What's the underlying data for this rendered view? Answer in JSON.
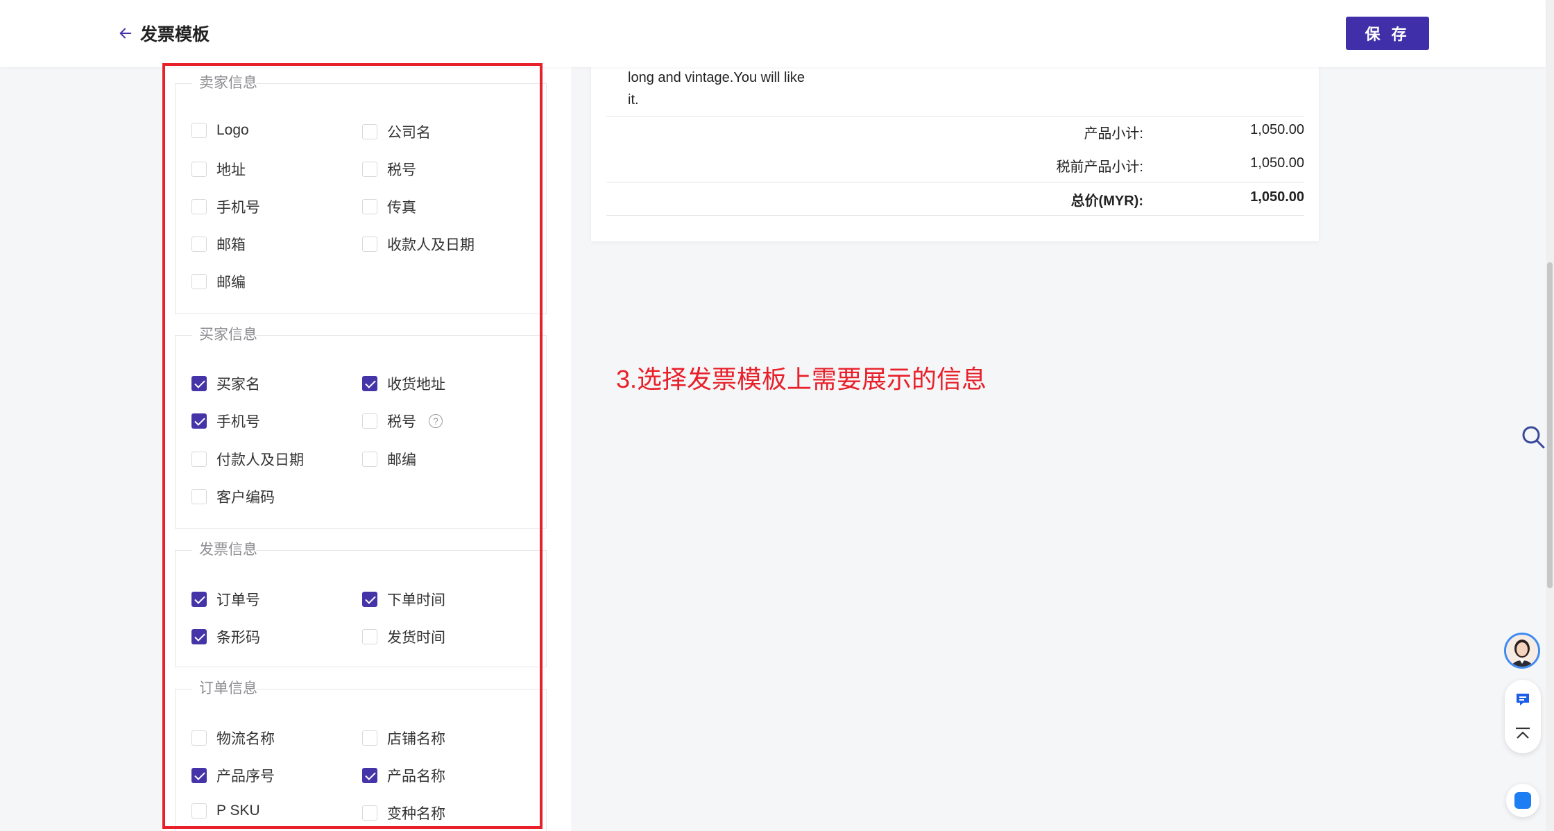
{
  "header": {
    "title": "发票模板",
    "save_label": "保 存"
  },
  "seller": {
    "legend": "卖家信息",
    "options": [
      {
        "label": "Logo",
        "checked": false
      },
      {
        "label": "公司名",
        "checked": false
      },
      {
        "label": "地址",
        "checked": false
      },
      {
        "label": "税号",
        "checked": false
      },
      {
        "label": "手机号",
        "checked": false
      },
      {
        "label": "传真",
        "checked": false
      },
      {
        "label": "邮箱",
        "checked": false
      },
      {
        "label": "收款人及日期",
        "checked": false
      },
      {
        "label": "邮编",
        "checked": false
      }
    ]
  },
  "buyer": {
    "legend": "买家信息",
    "options": [
      {
        "label": "买家名",
        "checked": true
      },
      {
        "label": "收货地址",
        "checked": true
      },
      {
        "label": "手机号",
        "checked": true
      },
      {
        "label": "税号",
        "checked": false
      },
      {
        "label": "付款人及日期",
        "checked": false
      },
      {
        "label": "邮编",
        "checked": false
      },
      {
        "label": "客户编码",
        "checked": false
      }
    ],
    "help_glyph": "?"
  },
  "invoice": {
    "legend": "发票信息",
    "options": [
      {
        "label": "订单号",
        "checked": true
      },
      {
        "label": "下单时间",
        "checked": true
      },
      {
        "label": "条形码",
        "checked": true
      },
      {
        "label": "发货时间",
        "checked": false
      }
    ]
  },
  "order": {
    "legend": "订单信息",
    "options": [
      {
        "label": "物流名称",
        "checked": false
      },
      {
        "label": "店铺名称",
        "checked": false
      },
      {
        "label": "产品序号",
        "checked": true
      },
      {
        "label": "产品名称",
        "checked": true
      },
      {
        "label": "P SKU",
        "checked": false
      },
      {
        "label": "变种名称",
        "checked": false
      }
    ]
  },
  "preview": {
    "desc_line1": "long and vintage.You will like",
    "desc_line2": "it.",
    "summary": [
      {
        "label": "产品小计:",
        "value": "1,050.00"
      },
      {
        "label": "税前产品小计:",
        "value": "1,050.00"
      },
      {
        "label": "总价(MYR):",
        "value": "1,050.00"
      }
    ]
  },
  "annotation": "3.选择发票模板上需要展示的信息",
  "colors": {
    "accent": "#4434a8",
    "highlight": "#e8202a"
  }
}
